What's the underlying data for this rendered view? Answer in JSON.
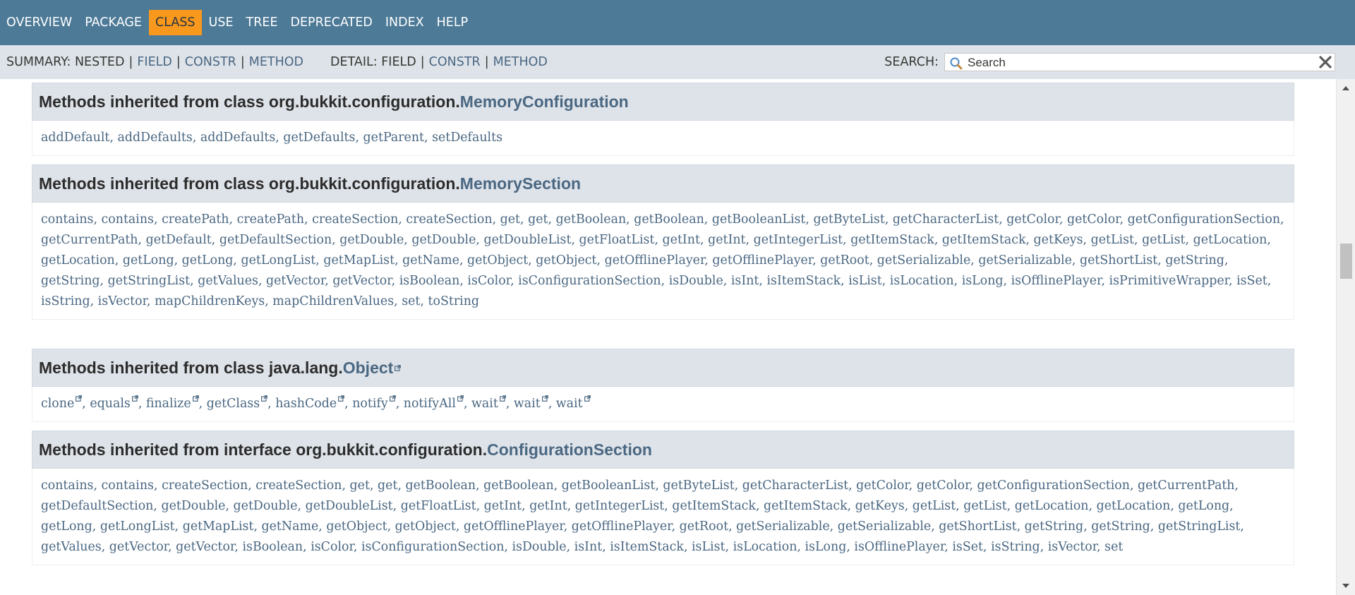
{
  "topnav": {
    "items": [
      "OVERVIEW",
      "PACKAGE",
      "CLASS",
      "USE",
      "TREE",
      "DEPRECATED",
      "INDEX",
      "HELP"
    ],
    "active": "CLASS"
  },
  "subnav": {
    "summary_label": "SUMMARY:",
    "summary_nested": "NESTED",
    "summary_field": "FIELD",
    "summary_constr": "CONSTR",
    "summary_method": "METHOD",
    "detail_label": "DETAIL:",
    "detail_field": "FIELD",
    "detail_constr": "CONSTR",
    "detail_method": "METHOD",
    "separator": "|"
  },
  "search": {
    "label": "SEARCH:",
    "placeholder": "Search"
  },
  "blocks": [
    {
      "prefix": "Methods inherited from class org.bukkit.configuration.",
      "link": "MemoryConfiguration",
      "external": false,
      "methods": [
        "addDefault",
        "addDefaults",
        "addDefaults",
        "getDefaults",
        "getParent",
        "setDefaults"
      ]
    },
    {
      "prefix": "Methods inherited from class org.bukkit.configuration.",
      "link": "MemorySection",
      "external": false,
      "methods": [
        "contains",
        "contains",
        "createPath",
        "createPath",
        "createSection",
        "createSection",
        "get",
        "get",
        "getBoolean",
        "getBoolean",
        "getBooleanList",
        "getByteList",
        "getCharacterList",
        "getColor",
        "getColor",
        "getConfigurationSection",
        "getCurrentPath",
        "getDefault",
        "getDefaultSection",
        "getDouble",
        "getDouble",
        "getDoubleList",
        "getFloatList",
        "getInt",
        "getInt",
        "getIntegerList",
        "getItemStack",
        "getItemStack",
        "getKeys",
        "getList",
        "getList",
        "getLocation",
        "getLocation",
        "getLong",
        "getLong",
        "getLongList",
        "getMapList",
        "getName",
        "getObject",
        "getObject",
        "getOfflinePlayer",
        "getOfflinePlayer",
        "getRoot",
        "getSerializable",
        "getSerializable",
        "getShortList",
        "getString",
        "getString",
        "getStringList",
        "getValues",
        "getVector",
        "getVector",
        "isBoolean",
        "isColor",
        "isConfigurationSection",
        "isDouble",
        "isInt",
        "isItemStack",
        "isList",
        "isLocation",
        "isLong",
        "isOfflinePlayer",
        "isPrimitiveWrapper",
        "isSet",
        "isString",
        "isVector",
        "mapChildrenKeys",
        "mapChildrenValues",
        "set",
        "toString"
      ]
    },
    {
      "prefix": "Methods inherited from class java.lang.",
      "link": "Object",
      "external": true,
      "methods": [
        "clone",
        "equals",
        "finalize",
        "getClass",
        "hashCode",
        "notify",
        "notifyAll",
        "wait",
        "wait",
        "wait"
      ]
    },
    {
      "prefix": "Methods inherited from interface org.bukkit.configuration.",
      "link": "ConfigurationSection",
      "external": false,
      "methods": [
        "contains",
        "contains",
        "createSection",
        "createSection",
        "get",
        "get",
        "getBoolean",
        "getBoolean",
        "getBooleanList",
        "getByteList",
        "getCharacterList",
        "getColor",
        "getColor",
        "getConfigurationSection",
        "getCurrentPath",
        "getDefaultSection",
        "getDouble",
        "getDouble",
        "getDoubleList",
        "getFloatList",
        "getInt",
        "getInt",
        "getIntegerList",
        "getItemStack",
        "getItemStack",
        "getKeys",
        "getList",
        "getList",
        "getLocation",
        "getLocation",
        "getLong",
        "getLong",
        "getLongList",
        "getMapList",
        "getName",
        "getObject",
        "getObject",
        "getOfflinePlayer",
        "getOfflinePlayer",
        "getRoot",
        "getSerializable",
        "getSerializable",
        "getShortList",
        "getString",
        "getString",
        "getStringList",
        "getValues",
        "getVector",
        "getVector",
        "isBoolean",
        "isColor",
        "isConfigurationSection",
        "isDouble",
        "isInt",
        "isItemStack",
        "isList",
        "isLocation",
        "isLong",
        "isOfflinePlayer",
        "isSet",
        "isString",
        "isVector",
        "set"
      ]
    }
  ],
  "colors": {
    "topnav_bg": "#4d7a97",
    "active_tab_bg": "#f8981d",
    "subnav_bg": "#dee3e9",
    "link": "#4a6782"
  }
}
